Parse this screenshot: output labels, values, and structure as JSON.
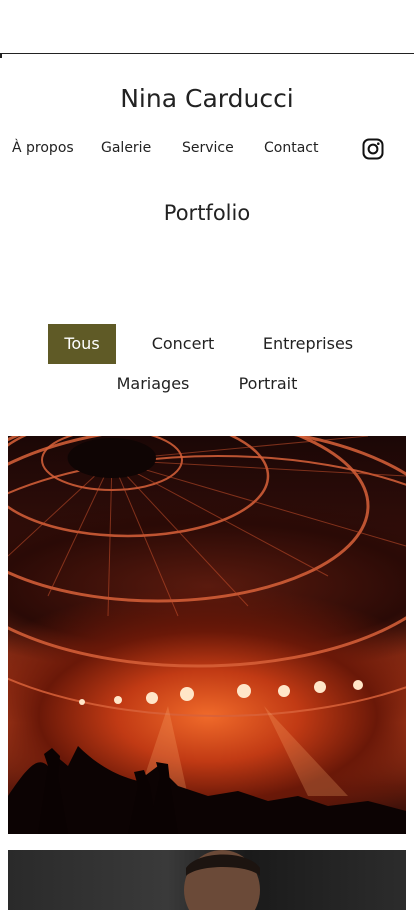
{
  "header": {
    "title": "Nina Carducci",
    "nav": [
      {
        "label": "À propos"
      },
      {
        "label": "Galerie"
      },
      {
        "label": "Service"
      },
      {
        "label": "Contact"
      }
    ],
    "social_icon": "instagram-icon"
  },
  "gallery": {
    "title": "Portfolio",
    "filters": [
      {
        "label": "Tous",
        "active": true
      },
      {
        "label": "Concert",
        "active": false
      },
      {
        "label": "Entreprises",
        "active": false
      },
      {
        "label": "Mariages",
        "active": false
      },
      {
        "label": "Portrait",
        "active": false
      }
    ],
    "photos": [
      {
        "subject": "concert-stage-red-lights"
      },
      {
        "subject": "portrait-man"
      }
    ]
  },
  "colors": {
    "accent": "#5f5a26",
    "text": "#222222",
    "background": "#ffffff"
  }
}
